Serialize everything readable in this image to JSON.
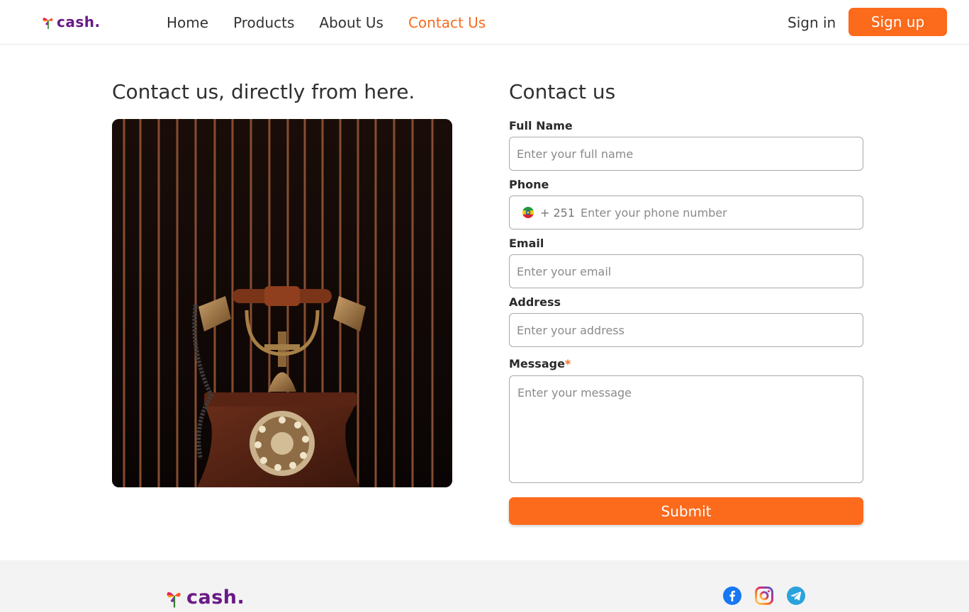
{
  "brand": {
    "name": "cash",
    "dot": "."
  },
  "nav": {
    "items": [
      {
        "label": "Home"
      },
      {
        "label": "Products"
      },
      {
        "label": "About Us"
      },
      {
        "label": "Contact Us"
      }
    ],
    "active": "Contact Us",
    "sign_in": "Sign in",
    "sign_up": "Sign up"
  },
  "left": {
    "title": "Contact us, directly from here.",
    "image_icon": "vintage-telephone-photo"
  },
  "form": {
    "title": "Contact us",
    "full_name": {
      "label": "Full Name",
      "placeholder": "Enter your full name",
      "value": ""
    },
    "phone": {
      "label": "Phone",
      "country_code": "+ 251",
      "flag": "ethiopia-flag-icon",
      "placeholder": "Enter your phone number",
      "value": ""
    },
    "email": {
      "label": "Email",
      "placeholder": "Enter your email",
      "value": ""
    },
    "address": {
      "label": "Address",
      "placeholder": "Enter your address",
      "value": ""
    },
    "message": {
      "label": "Message",
      "required_mark": "*",
      "placeholder": "Enter your message",
      "value": ""
    },
    "submit": "Submit"
  },
  "footer": {
    "social": [
      "facebook-icon",
      "instagram-icon",
      "telegram-icon"
    ]
  },
  "colors": {
    "accent": "#fc6a1c",
    "nav_active": "#f36c21",
    "brand_purple": "#6a1a86",
    "footer_bg": "#f3f3f3"
  }
}
